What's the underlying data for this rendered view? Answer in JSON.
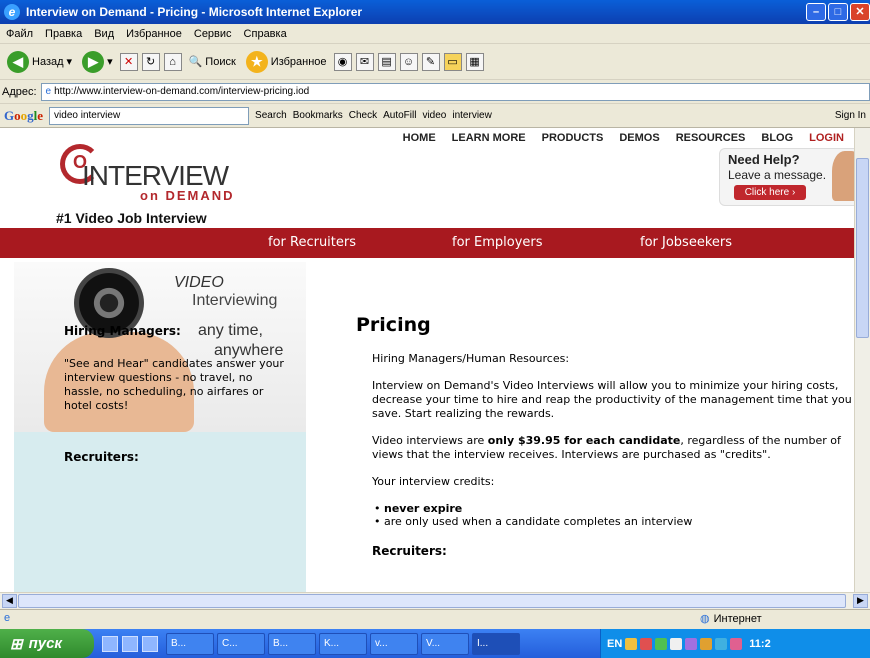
{
  "window": {
    "title": "Interview on Demand - Pricing - Microsoft Internet Explorer",
    "minimize": "–",
    "maximize": "□",
    "close": "✕"
  },
  "menu": [
    "Файл",
    "Правка",
    "Вид",
    "Избранное",
    "Сервис",
    "Справка"
  ],
  "toolbar": {
    "back": "Назад",
    "search": "Поиск",
    "favorites": "Избранное"
  },
  "address": {
    "label": "Адрес:",
    "url": "http://www.interview-on-demand.com/interview-pricing.iod"
  },
  "google": {
    "query": "video interview",
    "search": "Search",
    "bookmarks": "Bookmarks",
    "check": "Check",
    "autofill": "AutoFill",
    "chip1": "video",
    "chip2": "interview",
    "signin": "Sign In"
  },
  "nav": {
    "home": "HOME",
    "learn": "LEARN MORE",
    "products": "PRODUCTS",
    "demos": "DEMOS",
    "resources": "RESOURCES",
    "blog": "BLOG",
    "login": "LOGIN"
  },
  "logo": {
    "mark": "O",
    "word": "INTERVIEW",
    "sub": "on DEMAND",
    "tag": "#1 Video Job Interview"
  },
  "help": {
    "title": "Need Help?",
    "text": "Leave a message.",
    "button": "Click here ›"
  },
  "tabs": {
    "recruiters": "for Recruiters",
    "employers": "for Employers",
    "jobseekers": "for Jobseekers"
  },
  "promo": {
    "l1": "VIDEO",
    "l2": "Interviewing",
    "l3": "any time,",
    "l4": "anywhere"
  },
  "sidebar": {
    "h1": "Hiring Managers:",
    "text": "\"See and Hear\" candidates answer your interview questions - no travel, no hassle, no scheduling, no airfares or hotel costs!",
    "h2": "Recruiters:"
  },
  "main": {
    "title": "Pricing",
    "subhead": "Hiring Managers/Human Resources:",
    "p1": "Interview on Demand's Video Interviews will allow you to minimize your hiring costs, decrease your time to hire and reap the productivity of the management time that you save. Start realizing the rewards.",
    "p2a": "Video interviews are ",
    "p2b": "only $39.95 for each candidate",
    "p2c": ", regardless of the number of views that the interview receives. Interviews are purchased as \"credits\".",
    "p3": "Your interview credits:",
    "b1": "never expire",
    "b2": "are only used when a candidate completes an interview",
    "h2": "Recruiters:"
  },
  "status": {
    "zone": "Интернет"
  },
  "taskbar": {
    "start": "пуск",
    "items": [
      "B...",
      "C...",
      "B...",
      "K...",
      "v...",
      "V...",
      "I..."
    ],
    "lang": "EN",
    "clock": "11:2"
  }
}
